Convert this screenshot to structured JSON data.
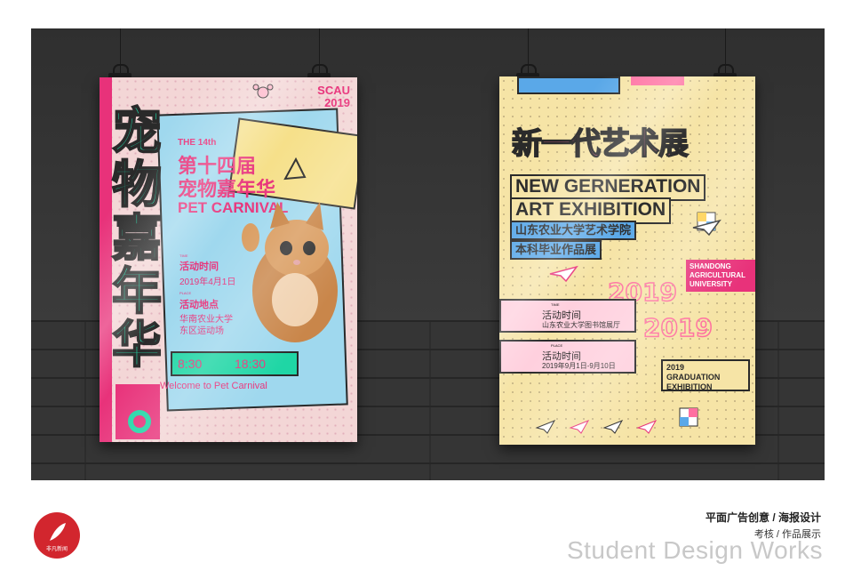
{
  "left_poster": {
    "vertical_title": "宠物嘉年华",
    "school_tag": "SCAU",
    "year_tag": "2019",
    "edition_en": "THE 14th",
    "title_line1": "第十四届",
    "title_line2": "宠物嘉年华",
    "title_en": "PET CARNIVAL",
    "time_label_en": "TIME",
    "time_label": "活动时间",
    "date": "2019年4月1日",
    "place_label_en": "PLACE",
    "place_label": "活动地点",
    "place_line1": "华南农业大学",
    "place_line2": "东区运动场",
    "start_time": "8:30",
    "end_time": "18:30",
    "welcome": "Welcome to Pet Carnival"
  },
  "right_poster": {
    "title_cn": "新一代艺术展",
    "title_en_line1": "NEW GERNERATION",
    "title_en_line2": "ART EXHIBITION",
    "school_cn": "山东农业大学艺术学院",
    "exhibit_cn": "本科毕业作品展",
    "university_en": [
      "SHANDONG",
      "AGRICULTURAL",
      "UNIVERSITY"
    ],
    "year": "2019",
    "time_label_en": "TIME",
    "time_label": "活动时间",
    "venue": "山东农业大学图书馆展厅",
    "place_label_en": "PLACE",
    "place_label": "活动时间",
    "dates": "2019年9月1日-9月10日",
    "graduation": [
      "2019",
      "GRADUATION",
      "EXHIBITION"
    ]
  },
  "footer": {
    "logo_text": "非凡新闻",
    "title": "平面广告创意 / 海报设计",
    "subtitle": "考核 / 作品展示",
    "english": "Student Design Works"
  },
  "colors": {
    "pink": "#e8327a",
    "mint": "#1fd6a5",
    "sky": "#9fd8ee",
    "cream": "#f6e4a6",
    "wall": "#3a3a3a"
  }
}
